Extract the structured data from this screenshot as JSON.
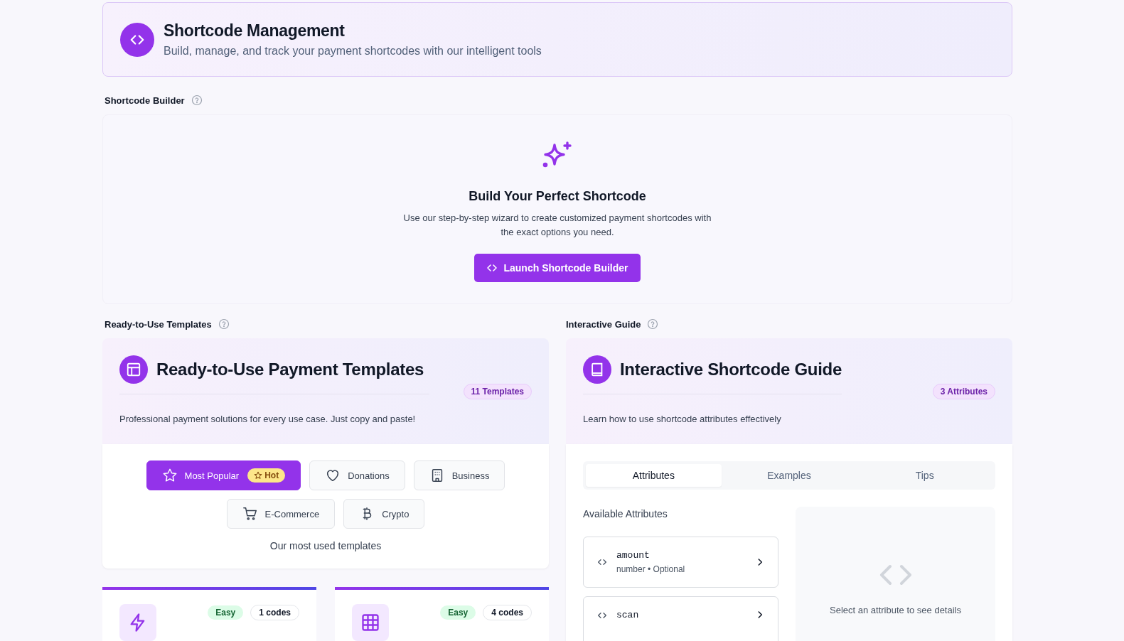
{
  "header": {
    "title": "Shortcode Management",
    "subtitle": "Build, manage, and track your payment shortcodes with our intelligent tools"
  },
  "builder": {
    "label": "Shortcode Builder",
    "title": "Build Your Perfect Shortcode",
    "description": "Use our step-by-step wizard to create customized payment shortcodes with the exact options you need.",
    "button": "Launch Shortcode Builder"
  },
  "templates": {
    "label": "Ready-to-Use Templates",
    "title": "Ready-to-Use Payment Templates",
    "count": "11 Templates",
    "description": "Professional payment solutions for every use case. Just copy and paste!",
    "categories": [
      {
        "label": "Most Popular",
        "kind": "star",
        "badge": "Hot",
        "selected": true
      },
      {
        "label": "Donations",
        "kind": "heart",
        "selected": false
      },
      {
        "label": "Business",
        "kind": "building",
        "selected": false
      },
      {
        "label": "E-Commerce",
        "kind": "cart",
        "selected": false
      },
      {
        "label": "Crypto",
        "kind": "bitcoin",
        "selected": false
      }
    ],
    "caption": "Our most used templates",
    "cards": [
      {
        "kind": "bolt",
        "difficulty": "Easy",
        "codes": "1 codes"
      },
      {
        "kind": "grid",
        "difficulty": "Easy",
        "codes": "4 codes"
      }
    ]
  },
  "guide": {
    "label": "Interactive Guide",
    "title": "Interactive Shortcode Guide",
    "count": "3 Attributes",
    "description": "Learn how to use shortcode attributes effectively",
    "tabs": [
      {
        "label": "Attributes",
        "selected": true
      },
      {
        "label": "Examples",
        "selected": false
      },
      {
        "label": "Tips",
        "selected": false
      }
    ],
    "attributes_title": "Available Attributes",
    "attributes": [
      {
        "name": "amount",
        "meta": "number • Optional"
      },
      {
        "name": "scan"
      }
    ],
    "empty_text": "Select an attribute to see details"
  }
}
